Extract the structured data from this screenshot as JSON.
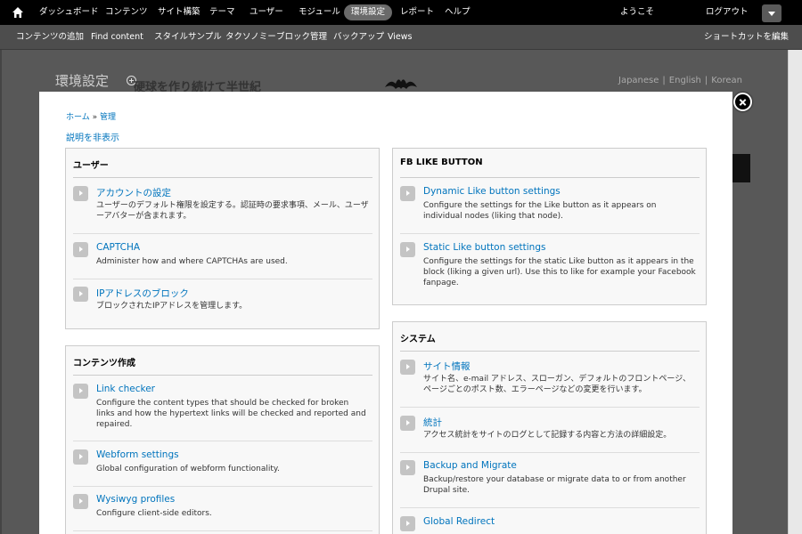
{
  "toolbar": {
    "home_icon": "home-icon",
    "items": [
      "ダッシュボード",
      "コンテンツ",
      "サイト構築",
      "テーマ",
      "ユーザー",
      "モジュール",
      "環境設定",
      "レポート",
      "ヘルプ"
    ],
    "active_item": "環境設定",
    "welcome": "ようこそ",
    "logout": "ログアウト"
  },
  "shortcuts": {
    "items": [
      "コンテンツの追加",
      "Find content",
      "スタイルサンプル",
      "タクソノミー",
      "ブロック管理",
      "バックアップ",
      "Views"
    ],
    "edit": "ショートカットを編集"
  },
  "background": {
    "title": "環境設定",
    "slogan": "硬球を作り続けて半世紀",
    "languages": [
      "Japanese",
      "English",
      "Korean"
    ]
  },
  "overlay": {
    "breadcrumb": [
      "ホーム",
      "管理"
    ],
    "breadcrumb_sep": "»",
    "hide_descriptions": "説明を非表示",
    "panels": [
      {
        "title": "ユーザー",
        "items": [
          {
            "title": "アカウントの設定",
            "description": "ユーザーのデフォルト権限を設定する。認証時の要求事項、メール、ユーザーアバターが含まれます。"
          },
          {
            "title": "CAPTCHA",
            "description": "Administer how and where CAPTCHAs are used."
          },
          {
            "title": "IPアドレスのブロック",
            "description": "ブロックされたIPアドレスを管理します。"
          }
        ]
      },
      {
        "title": "コンテンツ作成",
        "items": [
          {
            "title": "Link checker",
            "description": "Configure the content types that should be checked for broken links and how the hypertext links will be checked and reported and repaired."
          },
          {
            "title": "Webform settings",
            "description": "Global configuration of webform functionality."
          },
          {
            "title": "Wysiwyg profiles",
            "description": "Configure client-side editors."
          }
        ]
      },
      {
        "title": "FB LIKE BUTTON",
        "items": [
          {
            "title": "Dynamic Like button settings",
            "description": "Configure the settings for the Like button as it appears on individual nodes (liking that node)."
          },
          {
            "title": "Static Like button settings",
            "description": "Configure the settings for the static Like button as it appears in the block (liking a given url). Use this to like for example your Facebook fanpage."
          }
        ]
      },
      {
        "title": "システム",
        "items": [
          {
            "title": "サイト情報",
            "description": "サイト名、e-mail アドレス、スローガン、デフォルトのフロントページ、ページごとのポスト数、エラーページなどの変更を行います。"
          },
          {
            "title": "統計",
            "description": "アクセス統計をサイトのログとして記録する内容と方法の詳細設定。"
          },
          {
            "title": "Backup and Migrate",
            "description": "Backup/restore your database or migrate data to or from another Drupal site."
          },
          {
            "title": "Global Redirect",
            "description": ""
          }
        ]
      }
    ]
  },
  "colors": {
    "toolbar_bg": "#000000",
    "shortcut_bg": "#4d4d4d",
    "link": "#0074bd",
    "panel_bg": "#f8f8f8"
  }
}
